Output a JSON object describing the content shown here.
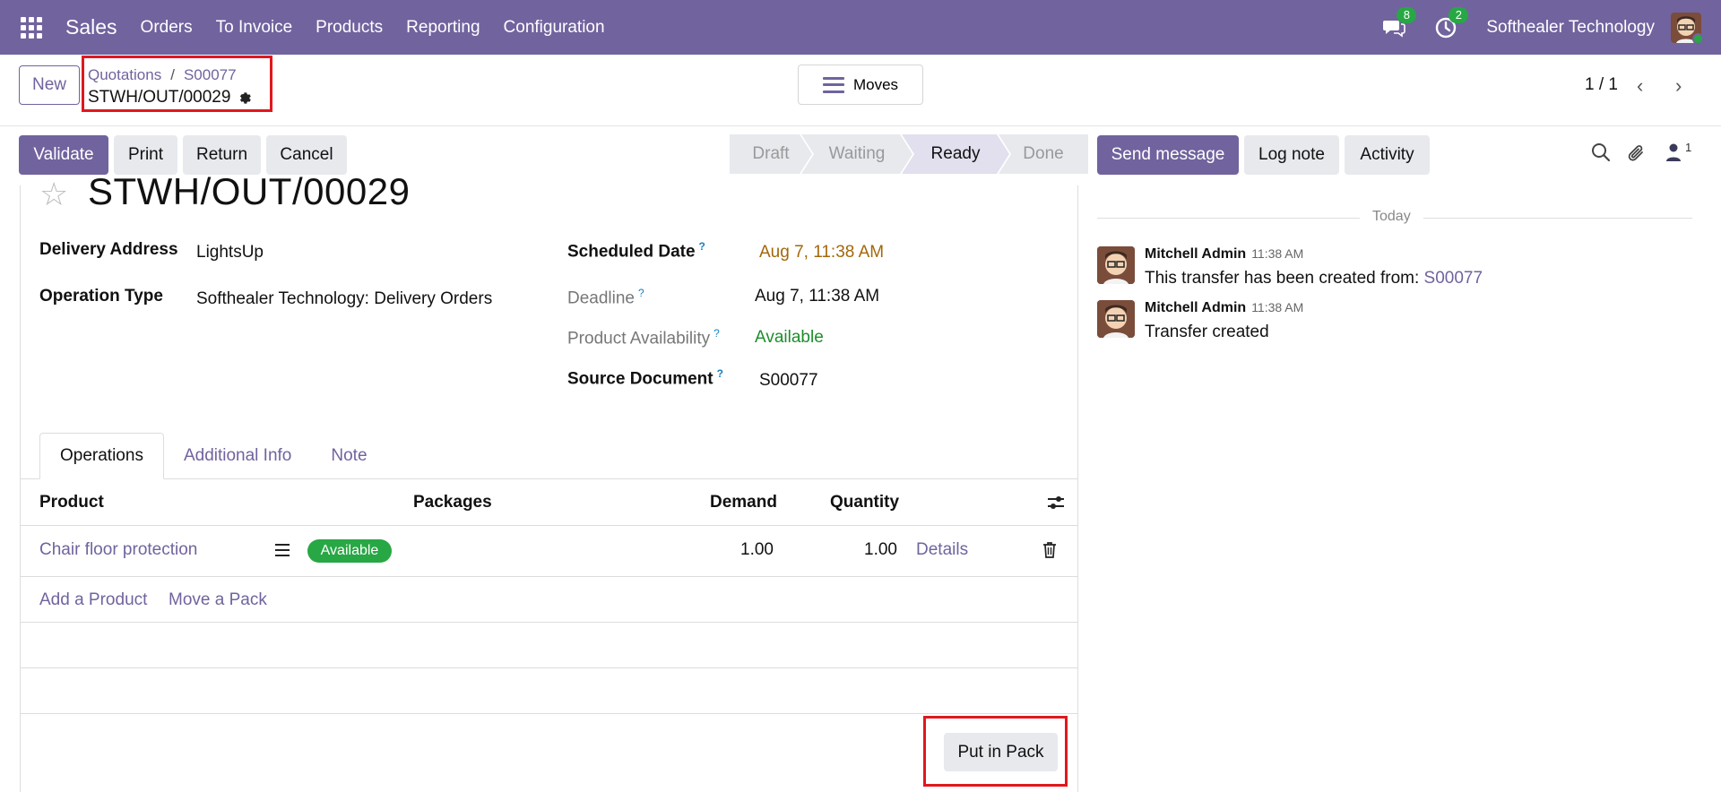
{
  "navbar": {
    "app_name": "Sales",
    "menu": [
      "Orders",
      "To Invoice",
      "Products",
      "Reporting",
      "Configuration"
    ],
    "messages_count": "8",
    "activities_count": "2",
    "company": "Softhealer Technology"
  },
  "control": {
    "new_label": "New",
    "breadcrumb": [
      "Quotations",
      "S00077"
    ],
    "record_name": "STWH/OUT/00029",
    "moves_label": "Moves",
    "pager": "1 / 1"
  },
  "actions": {
    "validate": "Validate",
    "print": "Print",
    "return": "Return",
    "cancel": "Cancel"
  },
  "status": {
    "stages": [
      "Draft",
      "Waiting",
      "Ready",
      "Done"
    ],
    "active": "Ready"
  },
  "chatter_actions": {
    "send_message": "Send message",
    "log_note": "Log note",
    "activity": "Activity",
    "followers_count": "1"
  },
  "form": {
    "title": "STWH/OUT/00029",
    "delivery_address_label": "Delivery Address",
    "delivery_address": "LightsUp",
    "operation_type_label": "Operation Type",
    "operation_type": "Softhealer Technology: Delivery Orders",
    "scheduled_date_label": "Scheduled Date",
    "scheduled_date": "Aug 7, 11:38 AM",
    "deadline_label": "Deadline",
    "deadline": "Aug 7, 11:38 AM",
    "availability_label": "Product Availability",
    "availability": "Available",
    "source_document_label": "Source Document",
    "source_document": "S00077",
    "help_mark": "?"
  },
  "tabs": [
    "Operations",
    "Additional Info",
    "Note"
  ],
  "table": {
    "headers": {
      "product": "Product",
      "packages": "Packages",
      "demand": "Demand",
      "quantity": "Quantity"
    },
    "rows": [
      {
        "product": "Chair floor protection",
        "status": "Available",
        "demand": "1.00",
        "quantity": "1.00",
        "details": "Details"
      }
    ],
    "add_product": "Add a Product",
    "move_pack": "Move a Pack",
    "put_in_pack": "Put in Pack"
  },
  "chatter": {
    "separator": "Today",
    "messages": [
      {
        "author": "Mitchell Admin",
        "time": "11:38 AM",
        "body": "This transfer has been created from: ",
        "link": "S00077"
      },
      {
        "author": "Mitchell Admin",
        "time": "11:38 AM",
        "body": "Transfer created",
        "link": ""
      }
    ]
  },
  "colors": {
    "brand": "#71639e",
    "success": "#28a745",
    "highlight_box": "#e0181d"
  }
}
